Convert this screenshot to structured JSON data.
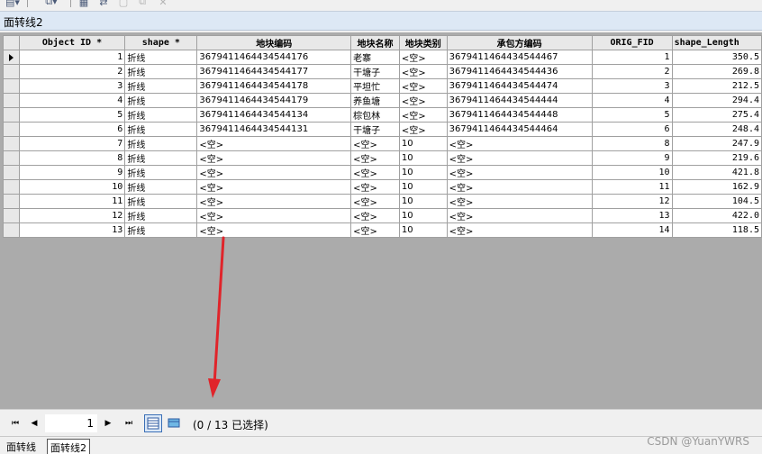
{
  "window": {
    "title": "面转线2"
  },
  "table": {
    "columns": [
      "Object ID *",
      "shape *",
      "地块编码",
      "地块名称",
      "地块类别",
      "承包方编码",
      "ORIG_FID",
      "shape_Length"
    ],
    "rows": [
      [
        "1",
        "折线",
        "3679411464434544176",
        "老寨",
        "<空>",
        "3679411464434544467",
        "1",
        "350.5"
      ],
      [
        "2",
        "折线",
        "3679411464434544177",
        "干塘子",
        "<空>",
        "3679411464434544436",
        "2",
        "269.8"
      ],
      [
        "3",
        "折线",
        "3679411464434544178",
        "平坦忙",
        "<空>",
        "3679411464434544474",
        "3",
        "212.5"
      ],
      [
        "4",
        "折线",
        "3679411464434544179",
        "养鱼塘",
        "<空>",
        "3679411464434544444",
        "4",
        "294.4"
      ],
      [
        "5",
        "折线",
        "3679411464434544134",
        "棕包林",
        "<空>",
        "3679411464434544448",
        "5",
        "275.4"
      ],
      [
        "6",
        "折线",
        "3679411464434544131",
        "干塘子",
        "<空>",
        "3679411464434544464",
        "6",
        "248.4"
      ],
      [
        "7",
        "折线",
        "<空>",
        "<空>",
        "10",
        "<空>",
        "8",
        "247.9"
      ],
      [
        "8",
        "折线",
        "<空>",
        "<空>",
        "10",
        "<空>",
        "9",
        "219.6"
      ],
      [
        "9",
        "折线",
        "<空>",
        "<空>",
        "10",
        "<空>",
        "10",
        "421.8"
      ],
      [
        "10",
        "折线",
        "<空>",
        "<空>",
        "10",
        "<空>",
        "11",
        "162.9"
      ],
      [
        "11",
        "折线",
        "<空>",
        "<空>",
        "10",
        "<空>",
        "12",
        "104.5"
      ],
      [
        "12",
        "折线",
        "<空>",
        "<空>",
        "10",
        "<空>",
        "13",
        "422.0"
      ],
      [
        "13",
        "折线",
        "<空>",
        "<空>",
        "10",
        "<空>",
        "14",
        "118.5"
      ]
    ]
  },
  "navigation": {
    "record": "1",
    "selection_status": "(0 / 13 已选择)"
  },
  "tabs": [
    {
      "label": "面转线",
      "active": false
    },
    {
      "label": "面转线2",
      "active": true
    }
  ],
  "watermark": "CSDN @YuanYWRS",
  "colors": {
    "arrow": "#e0242a",
    "title_bar": "#dde8f5",
    "grid_background": "#ababab"
  }
}
